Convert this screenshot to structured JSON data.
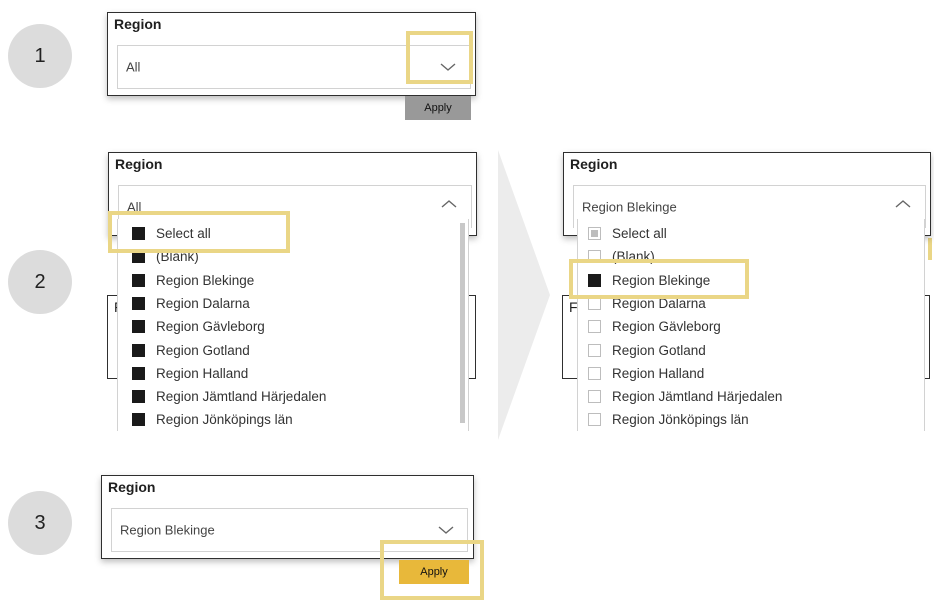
{
  "steps": {
    "one": "1",
    "two": "2",
    "three": "3"
  },
  "slicer_title": "Region",
  "panel1": {
    "value": "All",
    "apply_label": "Apply"
  },
  "panel2_left": {
    "value": "All",
    "items": [
      {
        "label": "Select all",
        "state": "checked"
      },
      {
        "label": "(Blank)",
        "state": "checked"
      },
      {
        "label": "Region Blekinge",
        "state": "checked"
      },
      {
        "label": "Region Dalarna",
        "state": "checked"
      },
      {
        "label": "Region Gävleborg",
        "state": "checked"
      },
      {
        "label": "Region Gotland",
        "state": "checked"
      },
      {
        "label": "Region Halland",
        "state": "checked"
      },
      {
        "label": "Region Jämtland Härjedalen",
        "state": "checked"
      },
      {
        "label": "Region Jönköpings län",
        "state": "checked"
      }
    ]
  },
  "panel2_right": {
    "value": "Region Blekinge",
    "items": [
      {
        "label": "Select all",
        "state": "partial"
      },
      {
        "label": "(Blank)",
        "state": "unchecked"
      },
      {
        "label": "Region Blekinge",
        "state": "checked"
      },
      {
        "label": "Region Dalarna",
        "state": "unchecked"
      },
      {
        "label": "Region Gävleborg",
        "state": "unchecked"
      },
      {
        "label": "Region Gotland",
        "state": "unchecked"
      },
      {
        "label": "Region Halland",
        "state": "unchecked"
      },
      {
        "label": "Region Jämtland Härjedalen",
        "state": "unchecked"
      },
      {
        "label": "Region Jönköpings län",
        "state": "unchecked"
      }
    ]
  },
  "panel3": {
    "value": "Region Blekinge",
    "apply_label": "Apply"
  },
  "colors": {
    "highlight": "#ead686",
    "apply_active": "#e8b83a",
    "apply_inactive": "#999999",
    "checkbox_fill": "#1a1a1a"
  }
}
